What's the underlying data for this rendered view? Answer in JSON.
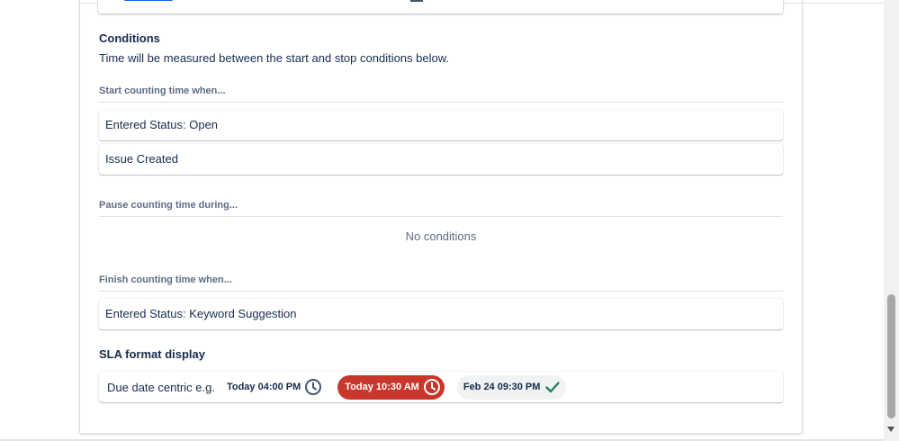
{
  "conditions": {
    "title": "Conditions",
    "description": "Time will be measured between the start and stop conditions below."
  },
  "start": {
    "label": "Start counting time when...",
    "items": [
      "Entered Status: Open",
      "Issue Created"
    ]
  },
  "pause": {
    "label": "Pause counting time during...",
    "empty_text": "No conditions"
  },
  "finish": {
    "label": "Finish counting time when...",
    "items": [
      "Entered Status: Keyword Suggestion"
    ]
  },
  "sla_format": {
    "title": "SLA format display",
    "label": "Due date centric e.g.",
    "examples": [
      {
        "text": "Today 04:00 PM",
        "icon": "clock-icon",
        "style": "plain"
      },
      {
        "text": "Today 10:30 AM",
        "icon": "clock-icon",
        "style": "breached"
      },
      {
        "text": "Feb 24 09:30 PM",
        "icon": "check-icon",
        "style": "met"
      }
    ]
  },
  "colors": {
    "breached": "#c9372c",
    "met_check": "#1f845a",
    "met_bg": "#f1f2f4",
    "text": "#172b4d",
    "subtle": "#5e6c84"
  }
}
